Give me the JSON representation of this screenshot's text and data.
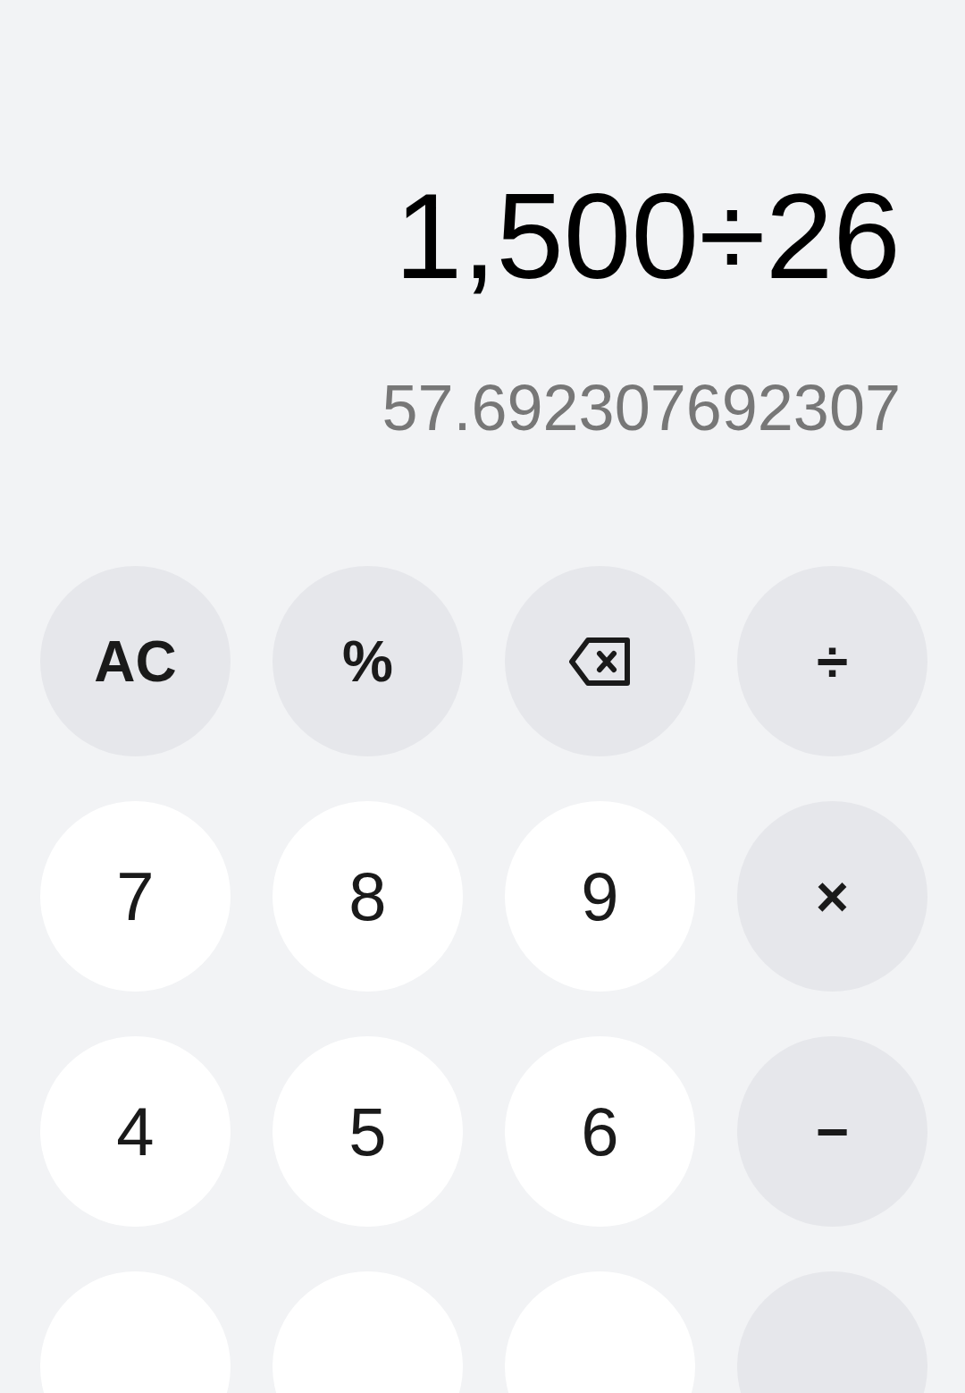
{
  "display": {
    "expression": "1,500÷26",
    "result": "57.692307692307"
  },
  "keypad": [
    [
      {
        "kind": "function",
        "label": "AC"
      },
      {
        "kind": "function",
        "label": "%"
      },
      {
        "kind": "backspace"
      },
      {
        "kind": "function",
        "label": "÷"
      }
    ],
    [
      {
        "kind": "digit",
        "label": "7"
      },
      {
        "kind": "digit",
        "label": "8"
      },
      {
        "kind": "digit",
        "label": "9"
      },
      {
        "kind": "function",
        "label": "×"
      }
    ],
    [
      {
        "kind": "digit",
        "label": "4"
      },
      {
        "kind": "digit",
        "label": "5"
      },
      {
        "kind": "digit",
        "label": "6"
      },
      {
        "kind": "function",
        "label": "−"
      }
    ],
    [
      {
        "kind": "digit"
      },
      {
        "kind": "digit"
      },
      {
        "kind": "digit"
      },
      {
        "kind": "function"
      }
    ]
  ]
}
